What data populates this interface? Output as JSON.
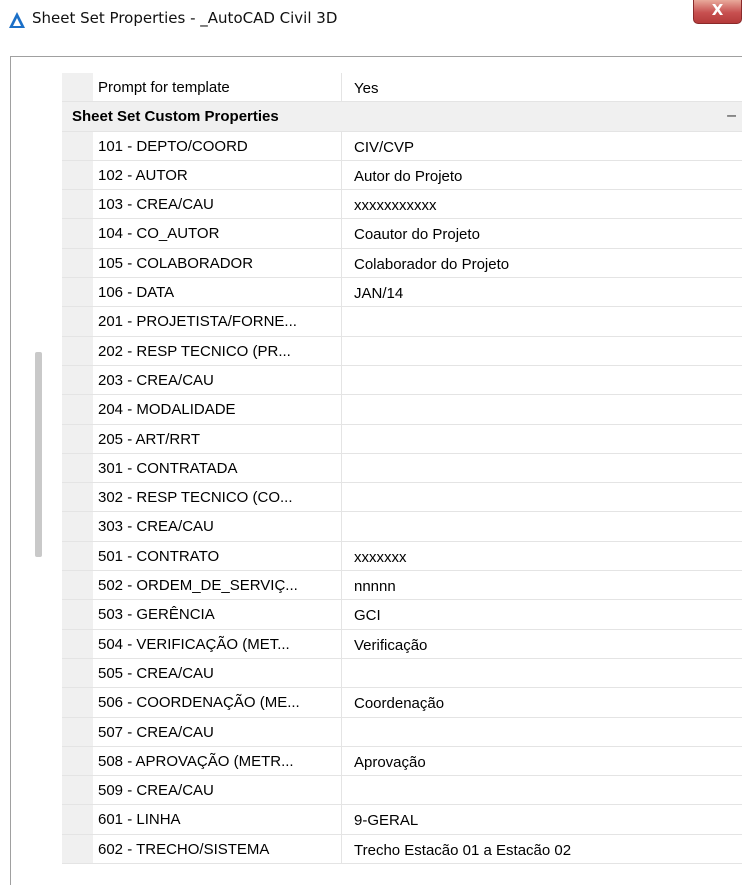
{
  "window": {
    "title": "Sheet Set Properties - _AutoCAD Civil 3D",
    "close_label": "X"
  },
  "rows_before": [
    {
      "name": "Prompt for template",
      "value": "Yes"
    }
  ],
  "category": {
    "label": "Sheet Set Custom Properties",
    "toggle": "–"
  },
  "properties": [
    {
      "name": "101 - DEPTO/COORD",
      "value": "CIV/CVP"
    },
    {
      "name": "102 - AUTOR",
      "value": "Autor do Projeto"
    },
    {
      "name": "103 - CREA/CAU",
      "value": "xxxxxxxxxxx"
    },
    {
      "name": "104 - CO_AUTOR",
      "value": "Coautor do Projeto"
    },
    {
      "name": "105 - COLABORADOR",
      "value": "Colaborador do Projeto"
    },
    {
      "name": "106 - DATA",
      "value": "JAN/14"
    },
    {
      "name": "201 - PROJETISTA/FORNE...",
      "value": ""
    },
    {
      "name": "202 - RESP TECNICO (PR...",
      "value": ""
    },
    {
      "name": "203 - CREA/CAU",
      "value": ""
    },
    {
      "name": "204 - MODALIDADE",
      "value": ""
    },
    {
      "name": "205 - ART/RRT",
      "value": ""
    },
    {
      "name": "301 - CONTRATADA",
      "value": ""
    },
    {
      "name": "302 - RESP TECNICO (CO...",
      "value": ""
    },
    {
      "name": "303 - CREA/CAU",
      "value": ""
    },
    {
      "name": "501 - CONTRATO",
      "value": "xxxxxxx"
    },
    {
      "name": "502 - ORDEM_DE_SERVIÇ...",
      "value": "nnnnn"
    },
    {
      "name": "503 - GERÊNCIA",
      "value": "GCI"
    },
    {
      "name": "504 - VERIFICAÇÃO (MET...",
      "value": "Verificação"
    },
    {
      "name": "505 - CREA/CAU",
      "value": ""
    },
    {
      "name": "506 - COORDENAÇÃO (ME...",
      "value": "Coordenação"
    },
    {
      "name": "507 - CREA/CAU",
      "value": ""
    },
    {
      "name": "508 - APROVAÇÃO (METR...",
      "value": "Aprovação"
    },
    {
      "name": "509 - CREA/CAU",
      "value": ""
    },
    {
      "name": "601 - LINHA",
      "value": "9-GERAL"
    },
    {
      "name": "602 - TRECHO/SISTEMA",
      "value": "Trecho Estacão 01 a Estacão 02"
    }
  ],
  "icons": {
    "app": "autocad-logo-icon",
    "close": "close-icon"
  }
}
